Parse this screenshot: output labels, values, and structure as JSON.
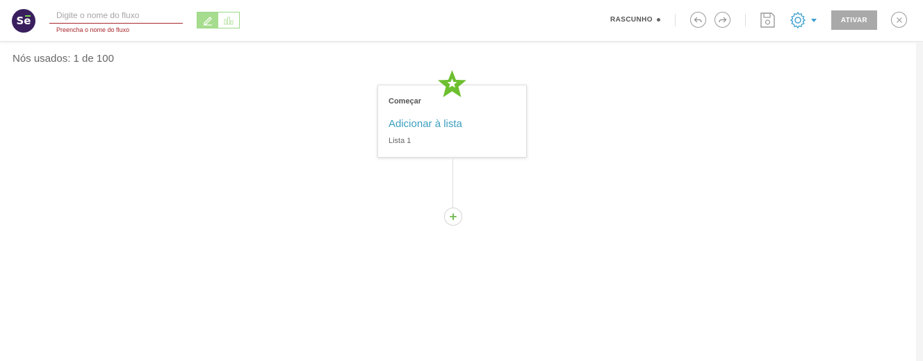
{
  "header": {
    "logo_text": "Se",
    "flow_name": {
      "value": "",
      "placeholder": "Digite o nome do fluxo",
      "error": "Preencha o nome do fluxo"
    },
    "status": "RASCUNHO",
    "activate_label": "ATIVAR",
    "icons": [
      "edit-icon",
      "chart-icon",
      "undo-icon",
      "redo-icon",
      "save-icon",
      "gear-icon",
      "close-icon"
    ]
  },
  "canvas": {
    "nodes_used": "Nós usados: 1 de 100",
    "start_node": {
      "title": "Começar",
      "action": "Adicionar à lista",
      "detail": "Lista 1"
    },
    "add_label": "+"
  },
  "colors": {
    "brand": "#3a1f5e",
    "accent_green": "#6cbf2e",
    "link_blue": "#3a9fbf",
    "error_red": "#a8262a",
    "button_gray": "#a9a9a9"
  }
}
